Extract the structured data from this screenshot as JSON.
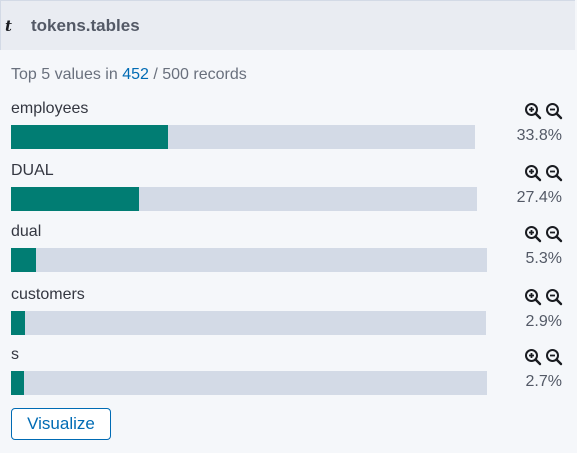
{
  "header": {
    "type_icon": "t",
    "field_name": "tokens.tables"
  },
  "summary": {
    "prefix": "Top 5 values in",
    "shown": "452",
    "separator": "/",
    "total_text": "500 records"
  },
  "values": [
    {
      "label": "employees",
      "fraction": 0.338,
      "percent": "33.8%"
    },
    {
      "label": "DUAL",
      "fraction": 0.274,
      "percent": "27.4%"
    },
    {
      "label": "dual",
      "fraction": 0.053,
      "percent": "5.3%"
    },
    {
      "label": "customers",
      "fraction": 0.029,
      "percent": "2.9%"
    },
    {
      "label": "s",
      "fraction": 0.027,
      "percent": "2.7%"
    }
  ],
  "icons": {
    "zoom_in": "zoom-in-icon",
    "zoom_out": "zoom-out-icon"
  },
  "colors": {
    "bar": "#017d73",
    "track": "#d3dae6",
    "link": "#006bb4"
  },
  "actions": {
    "visualize_label": "Visualize"
  }
}
